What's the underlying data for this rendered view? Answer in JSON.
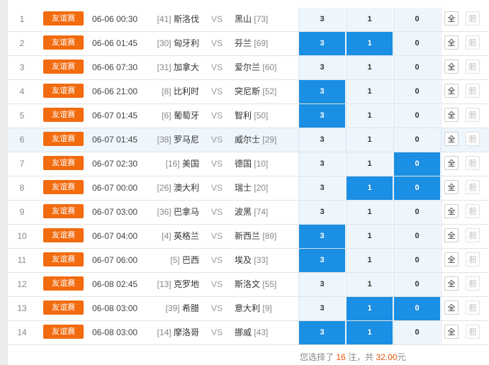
{
  "rows": [
    {
      "index": "1",
      "tag": "友谊赛",
      "time": "06-06 00:30",
      "home_rank": "[41]",
      "home": "斯洛伐",
      "vs": "VS",
      "away": "黑山",
      "away_rank": "[73]",
      "odds": [
        "3",
        "1",
        "0"
      ],
      "selected": [
        false,
        false,
        false
      ],
      "all_label": "全",
      "dan_label": "胆"
    },
    {
      "index": "2",
      "tag": "友谊赛",
      "time": "06-06 01:45",
      "home_rank": "[30]",
      "home": "匈牙利",
      "vs": "VS",
      "away": "芬兰",
      "away_rank": "[69]",
      "odds": [
        "3",
        "1",
        "0"
      ],
      "selected": [
        true,
        true,
        false
      ],
      "all_label": "全",
      "dan_label": "胆"
    },
    {
      "index": "3",
      "tag": "友谊赛",
      "time": "06-06 07:30",
      "home_rank": "[31]",
      "home": "加拿大",
      "vs": "VS",
      "away": "爱尔兰",
      "away_rank": "[60]",
      "odds": [
        "3",
        "1",
        "0"
      ],
      "selected": [
        false,
        false,
        false
      ],
      "all_label": "全",
      "dan_label": "胆"
    },
    {
      "index": "4",
      "tag": "友谊赛",
      "time": "06-06 21:00",
      "home_rank": "[8]",
      "home": "比利时",
      "vs": "VS",
      "away": "突尼斯",
      "away_rank": "[52]",
      "odds": [
        "3",
        "1",
        "0"
      ],
      "selected": [
        true,
        false,
        false
      ],
      "all_label": "全",
      "dan_label": "胆"
    },
    {
      "index": "5",
      "tag": "友谊赛",
      "time": "06-07 01:45",
      "home_rank": "[6]",
      "home": "葡萄牙",
      "vs": "VS",
      "away": "智利",
      "away_rank": "[50]",
      "odds": [
        "3",
        "1",
        "0"
      ],
      "selected": [
        true,
        false,
        false
      ],
      "all_label": "全",
      "dan_label": "胆"
    },
    {
      "index": "6",
      "tag": "友谊赛",
      "time": "06-07 01:45",
      "home_rank": "[38]",
      "home": "罗马尼",
      "vs": "VS",
      "away": "威尔士",
      "away_rank": "[29]",
      "odds": [
        "3",
        "1",
        "0"
      ],
      "selected": [
        false,
        false,
        false
      ],
      "all_label": "全",
      "dan_label": "胆",
      "highlight": true
    },
    {
      "index": "7",
      "tag": "友谊赛",
      "time": "06-07 02:30",
      "home_rank": "[16]",
      "home": "美国",
      "vs": "VS",
      "away": "德国",
      "away_rank": "[10]",
      "odds": [
        "3",
        "1",
        "0"
      ],
      "selected": [
        false,
        false,
        true
      ],
      "all_label": "全",
      "dan_label": "胆"
    },
    {
      "index": "8",
      "tag": "友谊赛",
      "time": "06-07 00:00",
      "home_rank": "[26]",
      "home": "澳大利",
      "vs": "VS",
      "away": "瑞士",
      "away_rank": "[20]",
      "odds": [
        "3",
        "1",
        "0"
      ],
      "selected": [
        false,
        true,
        true
      ],
      "all_label": "全",
      "dan_label": "胆"
    },
    {
      "index": "9",
      "tag": "友谊赛",
      "time": "06-07 03:00",
      "home_rank": "[36]",
      "home": "巴拿马",
      "vs": "VS",
      "away": "波黑",
      "away_rank": "[74]",
      "odds": [
        "3",
        "1",
        "0"
      ],
      "selected": [
        false,
        false,
        false
      ],
      "all_label": "全",
      "dan_label": "胆"
    },
    {
      "index": "10",
      "tag": "友谊赛",
      "time": "06-07 04:00",
      "home_rank": "[4]",
      "home": "英格兰",
      "vs": "VS",
      "away": "新西兰",
      "away_rank": "[89]",
      "odds": [
        "3",
        "1",
        "0"
      ],
      "selected": [
        true,
        false,
        false
      ],
      "all_label": "全",
      "dan_label": "胆"
    },
    {
      "index": "11",
      "tag": "友谊赛",
      "time": "06-07 06:00",
      "home_rank": "[5]",
      "home": "巴西",
      "vs": "VS",
      "away": "埃及",
      "away_rank": "[33]",
      "odds": [
        "3",
        "1",
        "0"
      ],
      "selected": [
        true,
        false,
        false
      ],
      "all_label": "全",
      "dan_label": "胆"
    },
    {
      "index": "12",
      "tag": "友谊赛",
      "time": "06-08 02:45",
      "home_rank": "[13]",
      "home": "克罗地",
      "vs": "VS",
      "away": "斯洛文",
      "away_rank": "[55]",
      "odds": [
        "3",
        "1",
        "0"
      ],
      "selected": [
        false,
        false,
        false
      ],
      "all_label": "全",
      "dan_label": "胆"
    },
    {
      "index": "13",
      "tag": "友谊赛",
      "time": "06-08 03:00",
      "home_rank": "[39]",
      "home": "希腊",
      "vs": "VS",
      "away": "意大利",
      "away_rank": "[9]",
      "odds": [
        "3",
        "1",
        "0"
      ],
      "selected": [
        false,
        true,
        true
      ],
      "all_label": "全",
      "dan_label": "胆"
    },
    {
      "index": "14",
      "tag": "友谊赛",
      "time": "06-08 03:00",
      "home_rank": "[14]",
      "home": "摩洛哥",
      "vs": "VS",
      "away": "挪威",
      "away_rank": "[43]",
      "odds": [
        "3",
        "1",
        "0"
      ],
      "selected": [
        true,
        true,
        false
      ],
      "all_label": "全",
      "dan_label": "胆"
    }
  ],
  "footer": {
    "prefix": "您选择了",
    "count": "16",
    "mid": "注，共",
    "amount": "32.00",
    "suffix": "元"
  },
  "colors": {
    "tag_bg": "#f26b0f",
    "selected_bg": "#1a8fe3",
    "odds_bg": "#eef6fd",
    "highlight_amount": "#e8540c"
  }
}
